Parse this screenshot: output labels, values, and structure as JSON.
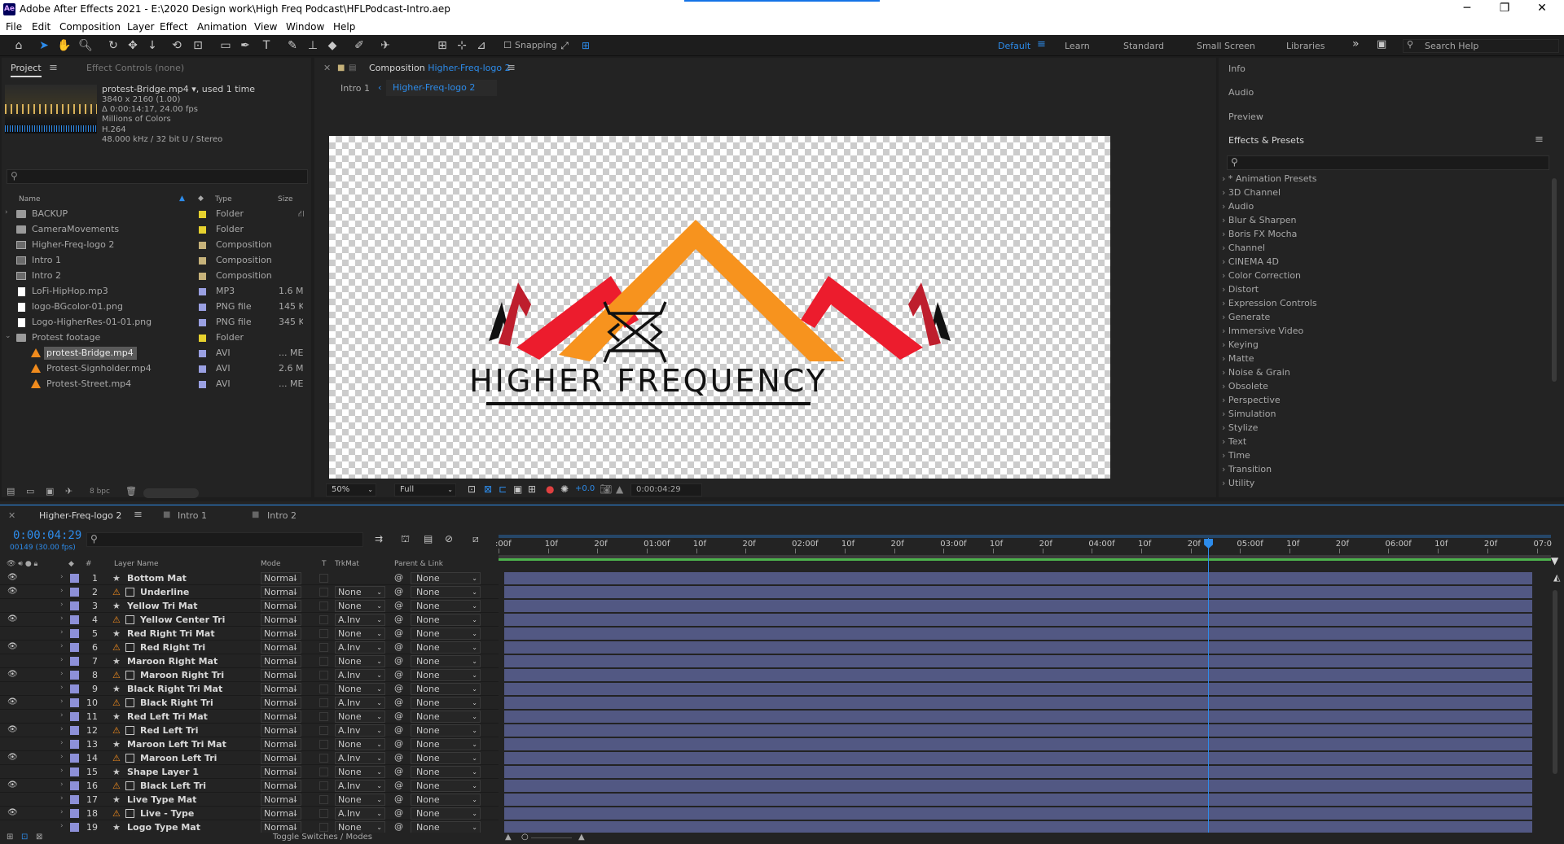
{
  "window": {
    "title": "Adobe After Effects 2021 - E:\\2020 Design work\\High Freq Podcast\\HFLPodcast-Intro.aep",
    "app_icon": "Ae",
    "minimize": "─",
    "maximize": "❐",
    "close": "✕"
  },
  "menu": [
    "File",
    "Edit",
    "Composition",
    "Layer",
    "Effect",
    "Animation",
    "View",
    "Window",
    "Help"
  ],
  "toolbar": {
    "snapping_label": "Snapping",
    "workspaces": [
      "Default",
      "Learn",
      "Standard",
      "Small Screen",
      "Libraries"
    ],
    "active_workspace": "Default",
    "more": "»",
    "search_help": "Search Help"
  },
  "project": {
    "tab_label": "Project",
    "effect_controls_label": "Effect Controls (none)",
    "selected_file": {
      "name": "protest-Bridge.mp4",
      "used": ", used 1 time",
      "resolution": "3840 x 2160 (1.00)",
      "duration": "Δ 0:00:14:17, 24.00 fps",
      "colors": "Millions of Colors",
      "codec": "H.264",
      "audio": "48.000 kHz / 32 bit U / Stereo"
    },
    "search_placeholder": "⚲",
    "columns": {
      "name": "Name",
      "type": "Type",
      "size": "Size"
    },
    "items": [
      {
        "name": "BACKUP",
        "type": "Folder",
        "size": "",
        "kind": "folder",
        "label_color": "#e6d12e",
        "twirl": "›",
        "indent": 0
      },
      {
        "name": "CameraMovements",
        "type": "Folder",
        "size": "",
        "kind": "folder",
        "label_color": "#e6d12e",
        "twirl": "",
        "indent": 0
      },
      {
        "name": "Higher-Freq-logo 2",
        "type": "Composition",
        "size": "",
        "kind": "comp",
        "label_color": "#c6b27a",
        "twirl": "",
        "indent": 0
      },
      {
        "name": "Intro 1",
        "type": "Composition",
        "size": "",
        "kind": "comp",
        "label_color": "#c6b27a",
        "twirl": "",
        "indent": 0
      },
      {
        "name": "Intro 2",
        "type": "Composition",
        "size": "",
        "kind": "comp",
        "label_color": "#c6b27a",
        "twirl": "",
        "indent": 0
      },
      {
        "name": "LoFi-HipHop.mp3",
        "type": "MP3",
        "size": "1.6 M",
        "kind": "file",
        "label_color": "#9aa0e2",
        "twirl": "",
        "indent": 0
      },
      {
        "name": "logo-BGcolor-01.png",
        "type": "PNG file",
        "size": "145 K",
        "kind": "file",
        "label_color": "#9aa0e2",
        "twirl": "",
        "indent": 0
      },
      {
        "name": "Logo-HigherRes-01-01.png",
        "type": "PNG file",
        "size": "345 K",
        "kind": "file",
        "label_color": "#9aa0e2",
        "twirl": "",
        "indent": 0
      },
      {
        "name": "Protest footage",
        "type": "Folder",
        "size": "",
        "kind": "folder",
        "label_color": "#e6d12e",
        "twirl": "⌄",
        "indent": 0
      },
      {
        "name": "protest-Bridge.mp4",
        "type": "AVI",
        "size": "... ME",
        "kind": "avi",
        "label_color": "#9aa0e2",
        "twirl": "",
        "indent": 1,
        "selected": true
      },
      {
        "name": "Protest-Signholder.mp4",
        "type": "AVI",
        "size": "2.6 M",
        "kind": "avi",
        "label_color": "#9aa0e2",
        "twirl": "",
        "indent": 1
      },
      {
        "name": "Protest-Street.mp4",
        "type": "AVI",
        "size": "... ME",
        "kind": "avi",
        "label_color": "#9aa0e2",
        "twirl": "",
        "indent": 1
      }
    ],
    "bpc": "8 bpc"
  },
  "composition": {
    "panel_label": "Composition",
    "comp_name": "Higher-Freq-logo 2",
    "breadcrumb": [
      "Intro 1",
      "Higher-Freq-logo 2"
    ],
    "zoom": "50%",
    "resolution": "Full",
    "exposure": "+0.0",
    "timecode": "0:00:04:29",
    "logo_text": "HIGHER FREQUENCY",
    "colors": {
      "orange": "#f7931e",
      "red": "#ec1c2d",
      "maroon": "#be1e2d",
      "black": "#111111"
    }
  },
  "right_panel": {
    "sections": [
      "Info",
      "Audio",
      "Preview"
    ],
    "effects_title": "Effects & Presets",
    "effects": [
      "* Animation Presets",
      "3D Channel",
      "Audio",
      "Blur & Sharpen",
      "Boris FX Mocha",
      "Channel",
      "CINEMA 4D",
      "Color Correction",
      "Distort",
      "Expression Controls",
      "Generate",
      "Immersive Video",
      "Keying",
      "Matte",
      "Noise & Grain",
      "Obsolete",
      "Perspective",
      "Simulation",
      "Stylize",
      "Text",
      "Time",
      "Transition",
      "Utility"
    ]
  },
  "timeline": {
    "tabs": [
      "Higher-Freq-logo 2",
      "Intro 1",
      "Intro 2"
    ],
    "timecode": "0:00:04:29",
    "frames": "00149 (30.00 fps)",
    "columns": {
      "layer_name": "Layer Name",
      "mode": "Mode",
      "t": "T",
      "trkmat": "TrkMat",
      "parent": "Parent & Link"
    },
    "ruler": [
      ":00f",
      "10f",
      "20f",
      "01:00f",
      "10f",
      "20f",
      "02:00f",
      "10f",
      "20f",
      "03:00f",
      "10f",
      "20f",
      "04:00f",
      "10f",
      "20f",
      "05:00f",
      "10f",
      "20f",
      "06:00f",
      "10f",
      "20f",
      "07:0"
    ],
    "current_time_fraction": 0.675,
    "layers": [
      {
        "num": "1",
        "name": "Bottom Mat",
        "mode": "Normal",
        "trkmat": "",
        "parent": "None",
        "type": "star",
        "eye": true
      },
      {
        "num": "2",
        "name": "Underline",
        "mode": "Normal",
        "trkmat": "None",
        "parent": "None",
        "type": "text",
        "eye": true
      },
      {
        "num": "3",
        "name": "Yellow Tri Mat",
        "mode": "Normal",
        "trkmat": "None",
        "parent": "None",
        "type": "star",
        "eye": false
      },
      {
        "num": "4",
        "name": "Yellow Center Tri",
        "mode": "Normal",
        "trkmat": "A.Inv",
        "parent": "None",
        "type": "text",
        "eye": true
      },
      {
        "num": "5",
        "name": "Red Right Tri Mat",
        "mode": "Normal",
        "trkmat": "None",
        "parent": "None",
        "type": "star",
        "eye": false
      },
      {
        "num": "6",
        "name": "Red Right Tri",
        "mode": "Normal",
        "trkmat": "A.Inv",
        "parent": "None",
        "type": "text",
        "eye": true
      },
      {
        "num": "7",
        "name": "Maroon Right Mat",
        "mode": "Normal",
        "trkmat": "None",
        "parent": "None",
        "type": "star",
        "eye": false
      },
      {
        "num": "8",
        "name": "Maroon Right Tri",
        "mode": "Normal",
        "trkmat": "A.Inv",
        "parent": "None",
        "type": "text",
        "eye": true
      },
      {
        "num": "9",
        "name": "Black Right Tri Mat",
        "mode": "Normal",
        "trkmat": "None",
        "parent": "None",
        "type": "star",
        "eye": false
      },
      {
        "num": "10",
        "name": "Black Right Tri",
        "mode": "Normal",
        "trkmat": "A.Inv",
        "parent": "None",
        "type": "text",
        "eye": true
      },
      {
        "num": "11",
        "name": "Red Left Tri Mat",
        "mode": "Normal",
        "trkmat": "None",
        "parent": "None",
        "type": "star",
        "eye": false
      },
      {
        "num": "12",
        "name": "Red Left Tri",
        "mode": "Normal",
        "trkmat": "A.Inv",
        "parent": "None",
        "type": "text",
        "eye": true
      },
      {
        "num": "13",
        "name": "Maroon Left Tri Mat",
        "mode": "Normal",
        "trkmat": "None",
        "parent": "None",
        "type": "star",
        "eye": false
      },
      {
        "num": "14",
        "name": "Maroon Left Tri",
        "mode": "Normal",
        "trkmat": "A.Inv",
        "parent": "None",
        "type": "text",
        "eye": true
      },
      {
        "num": "15",
        "name": "Shape Layer 1",
        "mode": "Normal",
        "trkmat": "None",
        "parent": "None",
        "type": "star",
        "eye": false
      },
      {
        "num": "16",
        "name": "Black Left Tri",
        "mode": "Normal",
        "trkmat": "A.Inv",
        "parent": "None",
        "type": "text",
        "eye": true
      },
      {
        "num": "17",
        "name": "Live Type Mat",
        "mode": "Normal",
        "trkmat": "None",
        "parent": "None",
        "type": "star",
        "eye": false
      },
      {
        "num": "18",
        "name": "Live - Type",
        "mode": "Normal",
        "trkmat": "A.Inv",
        "parent": "None",
        "type": "text",
        "eye": true
      },
      {
        "num": "19",
        "name": "Logo Type Mat",
        "mode": "Normal",
        "trkmat": "None",
        "parent": "None",
        "type": "star",
        "eye": false
      }
    ],
    "footer": "Toggle Switches / Modes"
  }
}
